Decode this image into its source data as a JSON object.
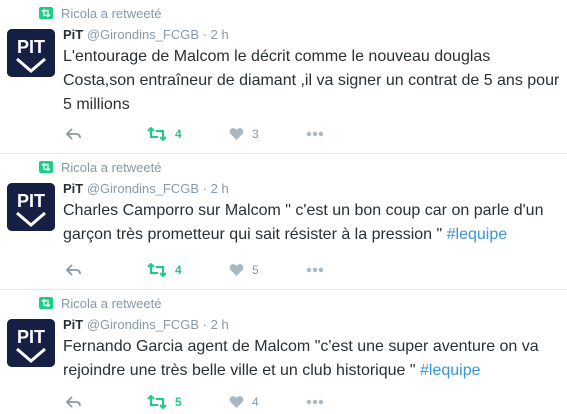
{
  "tweets": [
    {
      "retweeted_by": "Ricola a retweeté",
      "name": "PiT",
      "handle": "@Girondins_FCGB",
      "sep": "·",
      "time": "2 h",
      "text": "L'entourage de Malcom le décrit comme le nouveau douglas Costa,son entraîneur de diamant ,il va signer un contrat de 5 ans pour 5 millions",
      "hashtag": "",
      "retweets": "4",
      "likes": "3"
    },
    {
      "retweeted_by": "Ricola a retweeté",
      "name": "PiT",
      "handle": "@Girondins_FCGB",
      "sep": "·",
      "time": "2 h",
      "text": "Charles Camporro  sur Malcom \" c'est un bon coup car on parle d'un garçon très prometteur qui sait résister à la pression \" ",
      "hashtag": "#lequipe",
      "retweets": "4",
      "likes": "5"
    },
    {
      "retweeted_by": "Ricola a retweeté",
      "name": "PiT",
      "handle": "@Girondins_FCGB",
      "sep": "·",
      "time": "2 h",
      "text": "Fernando Garcia agent de Malcom \"c'est une super aventure on va rejoindre une très belle ville et un club historique \" ",
      "hashtag": "#lequipe",
      "retweets": "5",
      "likes": "4"
    }
  ],
  "avatar_label": "PIT",
  "colors": {
    "retweet_green": "#19cf86",
    "muted": "#8899a6",
    "hashtag_blue": "#3b94d9",
    "avatar_navy": "#152044"
  },
  "icons": [
    "retweet-icon",
    "reply-icon",
    "heart-icon",
    "more-icon"
  ]
}
